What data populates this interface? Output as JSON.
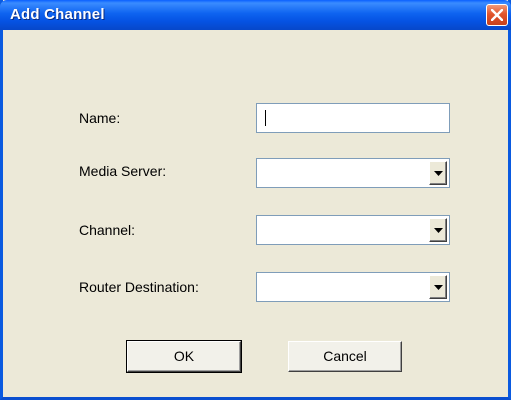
{
  "window": {
    "title": "Add Channel"
  },
  "form": {
    "name_label": "Name:",
    "name_value": "",
    "media_server_label": "Media Server:",
    "media_server_value": "",
    "channel_label": "Channel:",
    "channel_value": "",
    "router_destination_label": "Router Destination:",
    "router_destination_value": ""
  },
  "buttons": {
    "ok_label": "OK",
    "cancel_label": "Cancel"
  },
  "icons": {
    "close": "close-icon",
    "dropdown": "chevron-down-icon"
  },
  "colors": {
    "titlebar": "#0a60ff",
    "close_button": "#e2552d",
    "dialog_background": "#ece9d8"
  }
}
